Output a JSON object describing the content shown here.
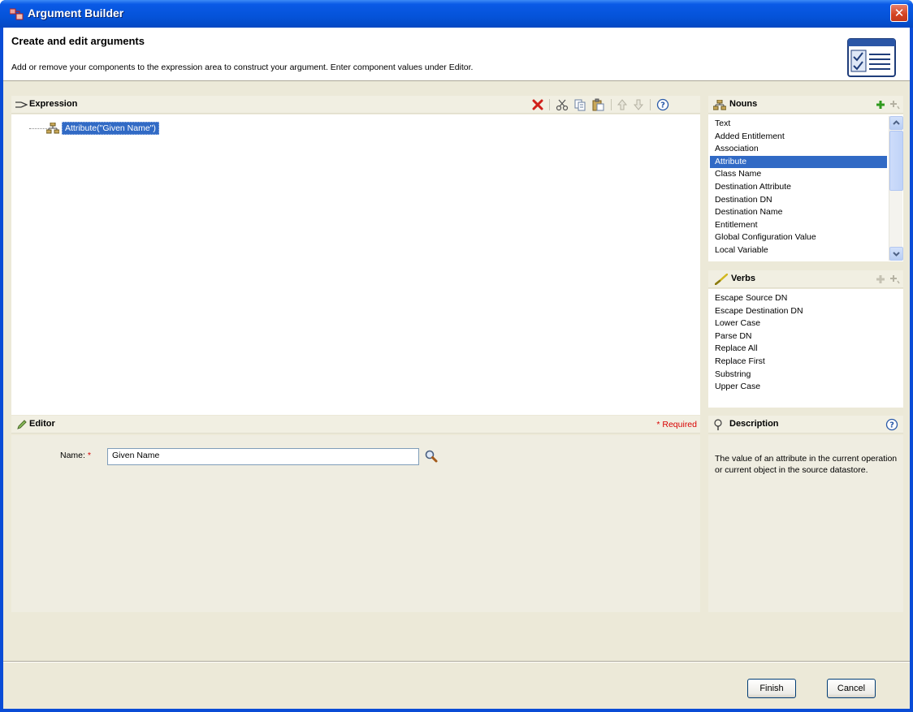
{
  "window": {
    "title": "Argument Builder"
  },
  "header": {
    "title": "Create and edit arguments",
    "description": "Add or remove your components to the expression area to construct your argument. Enter component values under Editor."
  },
  "expression": {
    "title": "Expression",
    "node": "Attribute(\"Given Name\")"
  },
  "nouns": {
    "title": "Nouns",
    "items": [
      "Text",
      "Added Entitlement",
      "Association",
      "Attribute",
      "Class Name",
      "Destination Attribute",
      "Destination DN",
      "Destination Name",
      "Entitlement",
      "Global Configuration Value",
      "Local Variable"
    ],
    "selected": "Attribute"
  },
  "verbs": {
    "title": "Verbs",
    "items": [
      "Escape Source DN",
      "Escape Destination DN",
      "Lower Case",
      "Parse DN",
      "Replace All",
      "Replace First",
      "Substring",
      "Upper Case"
    ]
  },
  "editor": {
    "title": "Editor",
    "required": "* Required",
    "name_label": "Name:",
    "name_star": "*",
    "name_value": "Given Name"
  },
  "description": {
    "title": "Description",
    "text": "The value of an attribute in the current operation or current object in the source datastore."
  },
  "buttons": {
    "finish": "Finish",
    "cancel": "Cancel"
  }
}
